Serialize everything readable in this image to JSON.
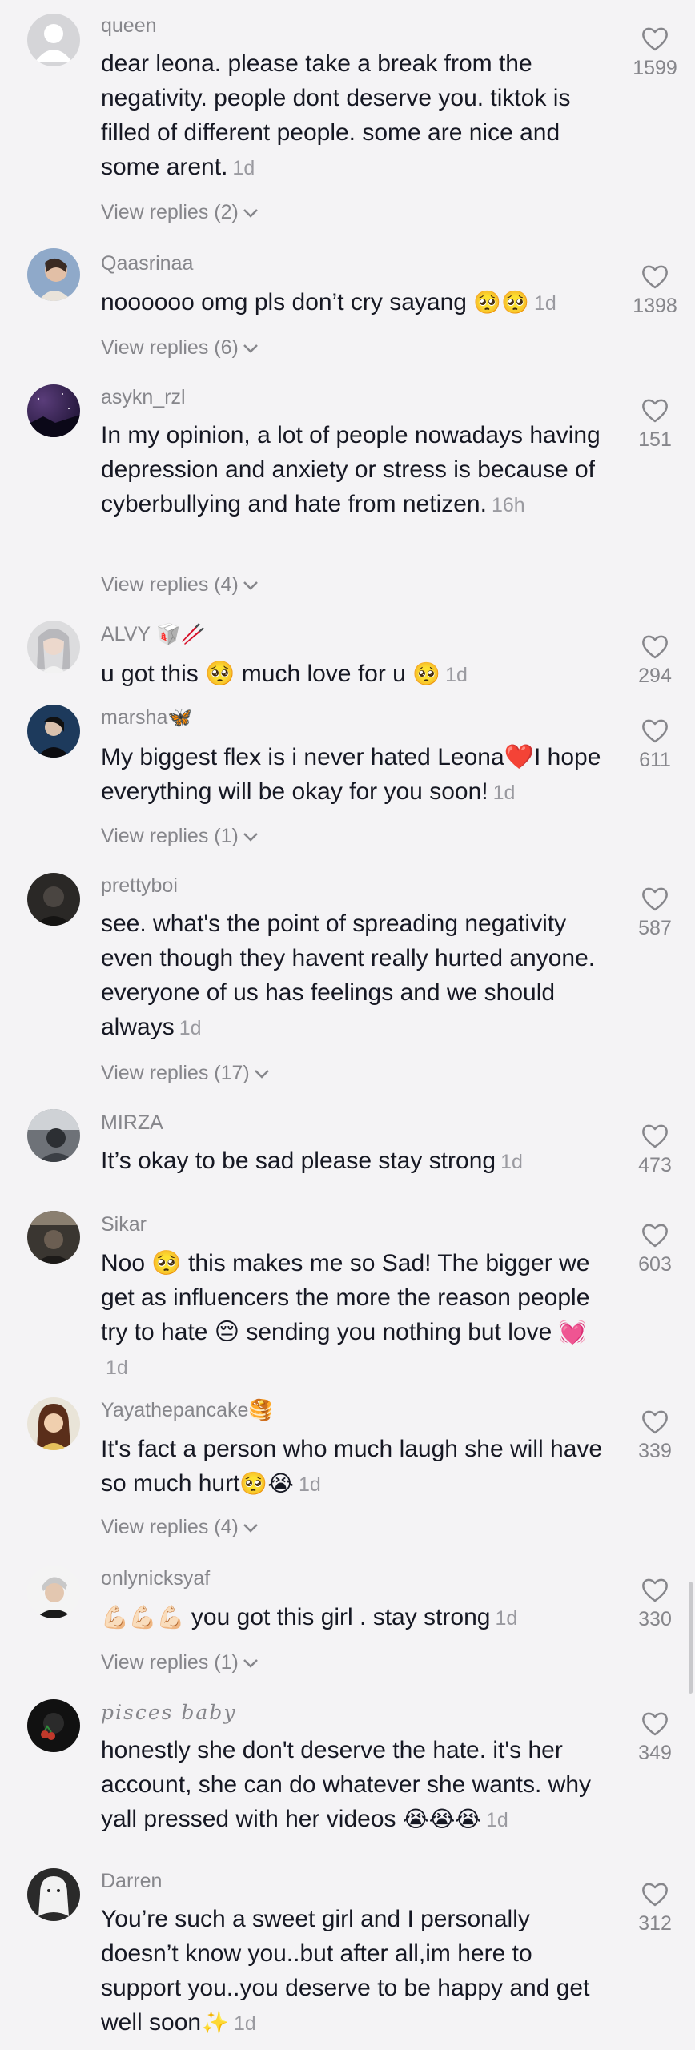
{
  "comments": [
    {
      "username": "queen",
      "text": "dear leona. please take a break from the negativity. people dont deserve you. tiktok is filled of different people. some are nice and some arent.",
      "emoji": "",
      "time": "1d",
      "replies": "View replies (2)",
      "likes": "1599"
    },
    {
      "username": "Qaasrinaa",
      "text": "noooooo omg pls don’t cry sayang ",
      "emoji": "🥺🥺",
      "time": "1d",
      "replies": "View replies (6)",
      "likes": "1398"
    },
    {
      "username": "asykn_rzl",
      "text": "In my opinion, a lot of people nowadays having depression and anxiety or stress is because of cyberbullying and hate from netizen.",
      "emoji": "",
      "time": "16h",
      "replies": "View replies (4)",
      "likes": "151"
    },
    {
      "username": "ALVY 🥡🥢",
      "text": "u got this 🥺 much love for u ",
      "emoji": "🥺",
      "time": "1d",
      "replies": "",
      "likes": "294"
    },
    {
      "username": "marsha🦋",
      "text": "My biggest flex is i never hated Leona❤️I hope everything will be okay for you soon!",
      "emoji": "",
      "time": "1d",
      "replies": "View replies (1)",
      "likes": "611"
    },
    {
      "username": "prettyboi",
      "text": "see. what's the point of spreading negativity even though they havent really hurted anyone. everyone of us has feelings and we should always",
      "emoji": "",
      "time": "1d",
      "replies": "View replies (17)",
      "likes": "587"
    },
    {
      "username": "MIRZA",
      "text": "It’s okay to be sad please stay strong",
      "emoji": "",
      "time": "1d",
      "replies": "",
      "likes": "473"
    },
    {
      "username": "Sikar",
      "text": "Noo 🥺 this makes me so Sad! The bigger we get as influencers the more the reason people try to hate 😔 sending you nothing but love ",
      "emoji": "💓",
      "time": "1d",
      "replies": "",
      "likes": "603"
    },
    {
      "username": "Yayathepancake🥞",
      "text": "It's fact a person who much laugh she will have so much hurt",
      "emoji": "🥺😭",
      "time": "1d",
      "replies": "View replies (4)",
      "likes": "339"
    },
    {
      "username": "onlynicksyaf",
      "text": " you got this girl . stay strong",
      "emoji": "💪🏻💪🏻💪🏻",
      "time": "1d",
      "replies": "View replies (1)",
      "likes": "330"
    },
    {
      "username": "pisces baby",
      "text": "honestly she don't deserve the hate. it's her account, she can do whatever she wants. why yall pressed with her videos ",
      "emoji": "😭😭😭",
      "time": "1d",
      "replies": "",
      "likes": "349"
    },
    {
      "username": "Darren",
      "text": "You’re such a sweet girl and I personally doesn’t know you..but after all,im here to support you..you deserve to be happy and get well soon",
      "emoji": "✨",
      "time": "1d",
      "replies": "",
      "likes": "312"
    }
  ],
  "icons": {
    "like": "heart-outline-icon",
    "expand": "chevron-down-icon"
  }
}
